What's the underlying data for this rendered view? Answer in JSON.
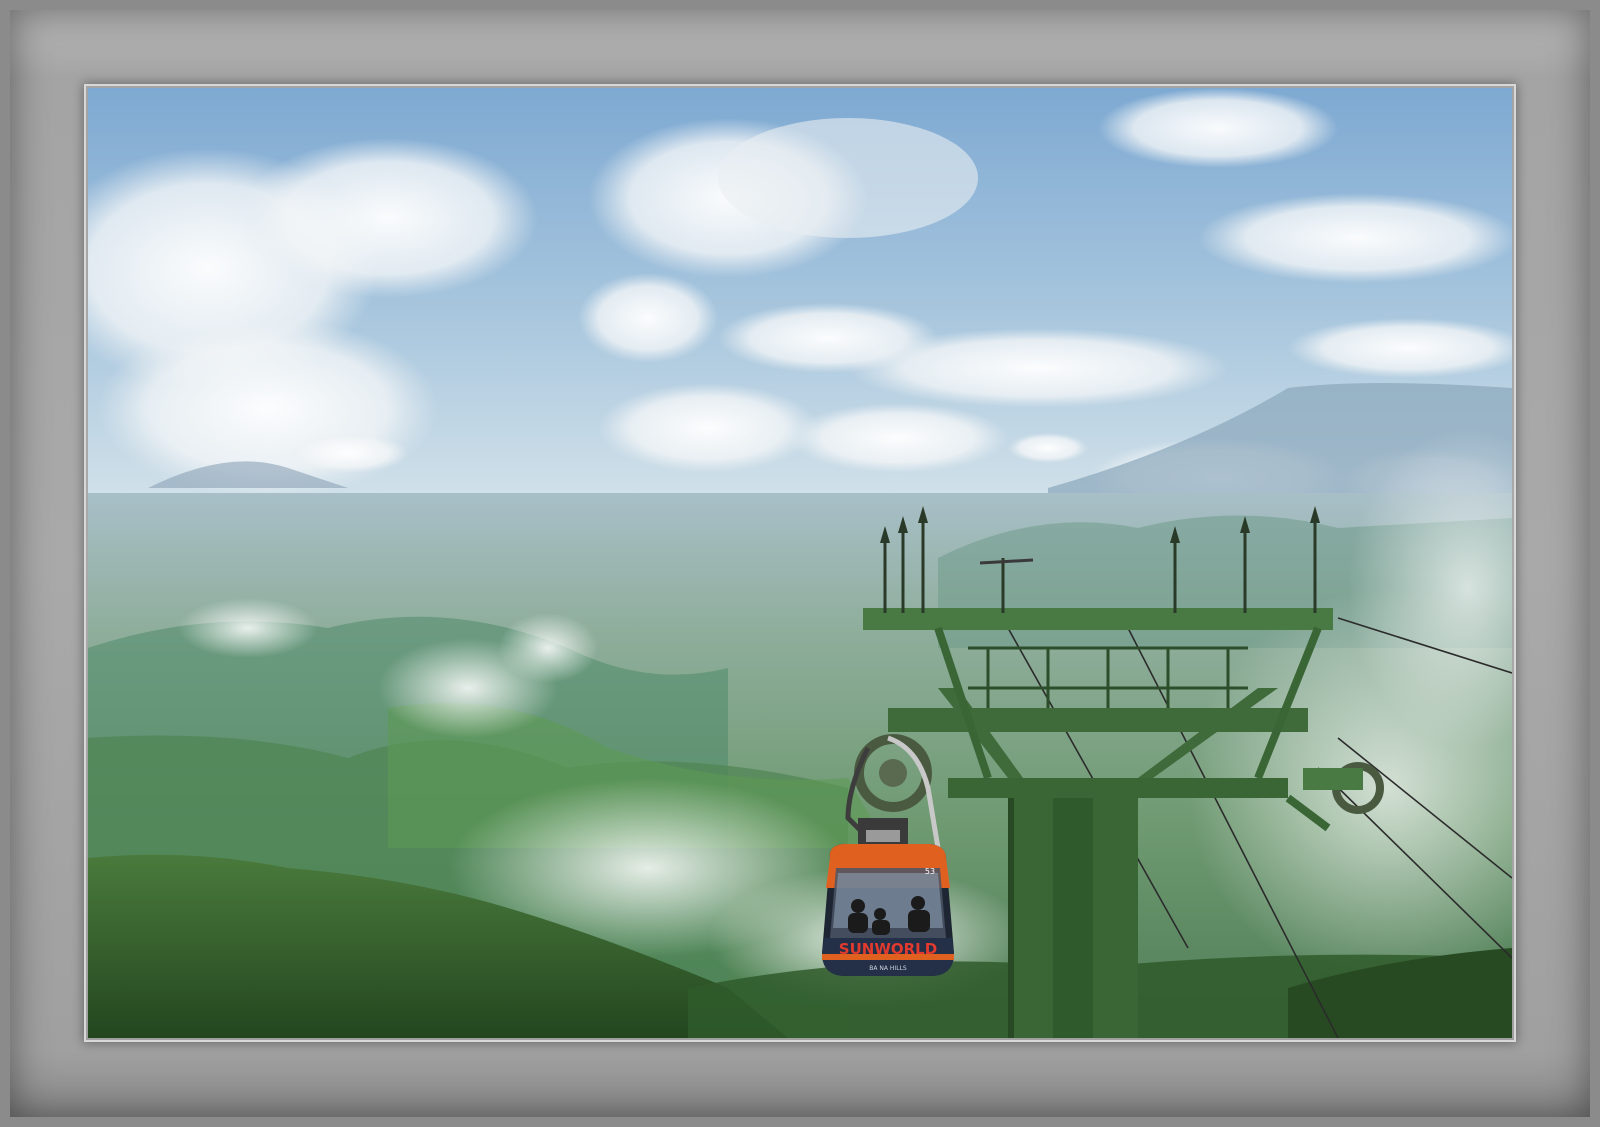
{
  "frame": {
    "outer_color": "#8b8b8b",
    "mat_color": "#a9a9a9"
  },
  "photo": {
    "subject": "cable-car-over-mountains",
    "colors": {
      "sky_top": "#8fb8da",
      "sky_horizon": "#c9dbe6",
      "valley": "#6f9a7a",
      "forest": "#2f5a2a",
      "pylon": "#3f6a3a",
      "gondola_body": "#e0611f"
    },
    "gondola": {
      "brand_text": "SUNWORLD",
      "sub_text": "BA NA HILLS",
      "number": "53"
    }
  }
}
